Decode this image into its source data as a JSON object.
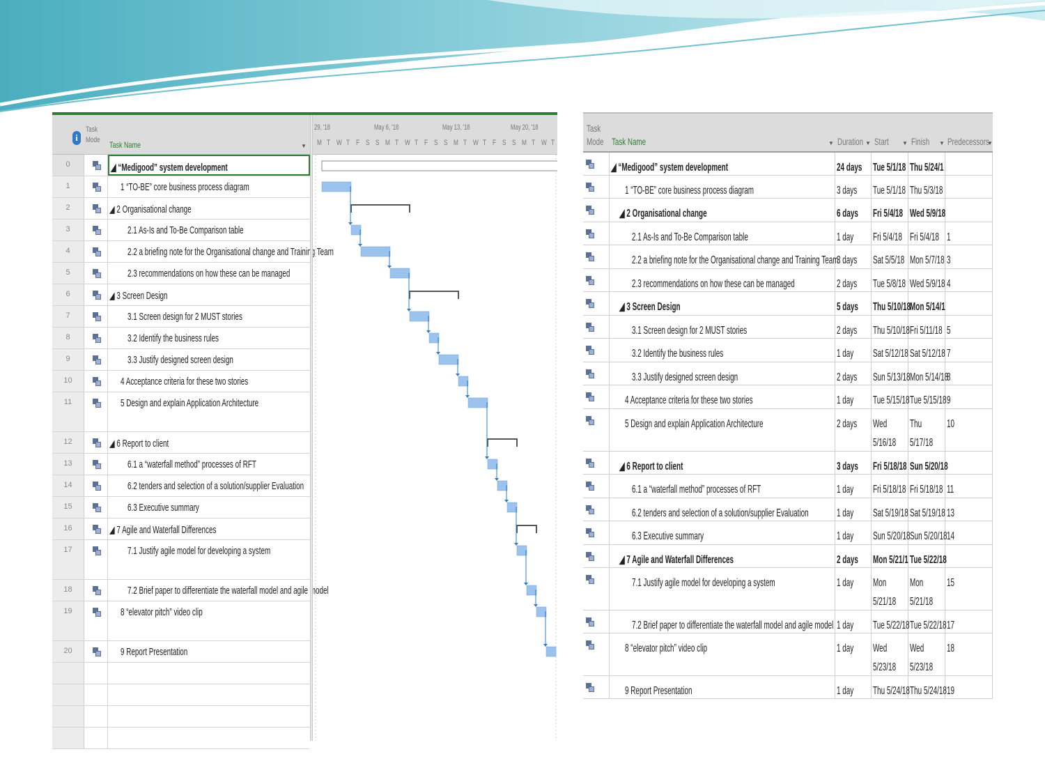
{
  "left_view": {
    "headers": {
      "info_icon": "i",
      "task_mode": "Task Mode",
      "task_name": "Task Name"
    },
    "timeline": {
      "weeks": [
        "29, '18",
        "May 6, '18",
        "May 13, '18",
        "May 20, '18"
      ],
      "day_letters": [
        "M",
        "T",
        "W",
        "T",
        "F",
        "S",
        "S",
        "M",
        "T",
        "W",
        "T",
        "F",
        "S",
        "S",
        "M",
        "T",
        "W",
        "T",
        "F",
        "S",
        "S",
        "M",
        "T",
        "W",
        "T"
      ]
    },
    "rows": [
      {
        "id": "0",
        "name": "◢ “Medigood” system development"
      },
      {
        "id": "1",
        "name": "1 “TO-BE” core business process diagram"
      },
      {
        "id": "2",
        "name": "◢ 2 Organisational change"
      },
      {
        "id": "3",
        "name": "2.1 As-Is and To-Be Comparison table"
      },
      {
        "id": "4",
        "name": "2.2 a briefing note for the Organisational change and Training Team"
      },
      {
        "id": "5",
        "name": "2.3 recommendations on how these can be managed"
      },
      {
        "id": "6",
        "name": "◢ 3 Screen Design"
      },
      {
        "id": "7",
        "name": "3.1 Screen design for 2 MUST stories"
      },
      {
        "id": "8",
        "name": "3.2 Identify the business rules"
      },
      {
        "id": "9",
        "name": "3.3 Justify designed screen design"
      },
      {
        "id": "10",
        "name": "4 Acceptance criteria for these two stories"
      },
      {
        "id": "11",
        "name": "5 Design and explain Application Architecture"
      },
      {
        "id": "12",
        "name": "◢ 6 Report to client"
      },
      {
        "id": "13",
        "name": "6.1 a “waterfall method” processes of RFT"
      },
      {
        "id": "14",
        "name": "6.2 tenders and selection of a solution/supplier Evaluation"
      },
      {
        "id": "15",
        "name": "6.3 Executive summary"
      },
      {
        "id": "16",
        "name": "◢ 7 Agile and Waterfall Differences"
      },
      {
        "id": "17",
        "name": "7.1 Justify agile model for developing a system"
      },
      {
        "id": "18",
        "name": "7.2 Brief paper to differentiate the waterfall model and agile model"
      },
      {
        "id": "19",
        "name": "8 “elevator pitch” video clip"
      },
      {
        "id": "20",
        "name": "9 Report Presentation"
      }
    ]
  },
  "right_view": {
    "headers": {
      "task_mode": "Task Mode",
      "task_name": "Task Name",
      "duration": "Duration",
      "start": "Start",
      "finish": "Finish",
      "predecessors": "Predecessors"
    },
    "rows": [
      {
        "name": "◢ “Medigood” system development",
        "duration": "24 days",
        "start": "Tue 5/1/18",
        "finish": "Thu 5/24/1",
        "pred": ""
      },
      {
        "name": "1 “TO-BE” core business process diagram",
        "duration": "3 days",
        "start": "Tue 5/1/18",
        "finish": "Thu 5/3/18",
        "pred": ""
      },
      {
        "name": "◢ 2 Organisational change",
        "duration": "6 days",
        "start": "Fri 5/4/18",
        "finish": "Wed 5/9/18",
        "pred": ""
      },
      {
        "name": "2.1 As-Is and To-Be Comparison table",
        "duration": "1 day",
        "start": "Fri 5/4/18",
        "finish": "Fri 5/4/18",
        "pred": "1"
      },
      {
        "name": "2.2 a briefing note for the Organisational change and Training Team",
        "duration": "3 days",
        "start": "Sat 5/5/18",
        "finish": "Mon 5/7/18",
        "pred": "3"
      },
      {
        "name": "2.3 recommendations on how these can be managed",
        "duration": "2 days",
        "start": "Tue 5/8/18",
        "finish": "Wed 5/9/18",
        "pred": "4"
      },
      {
        "name": "◢ 3 Screen Design",
        "duration": "5 days",
        "start": "Thu 5/10/18",
        "finish": "Mon 5/14/1",
        "pred": ""
      },
      {
        "name": "3.1 Screen design for 2 MUST stories",
        "duration": "2 days",
        "start": "Thu 5/10/18",
        "finish": "Fri 5/11/18",
        "pred": "5"
      },
      {
        "name": "3.2 Identify the business rules",
        "duration": "1 day",
        "start": "Sat 5/12/18",
        "finish": "Sat 5/12/18",
        "pred": "7"
      },
      {
        "name": "3.3 Justify designed screen design",
        "duration": "2 days",
        "start": "Sun 5/13/18",
        "finish": "Mon 5/14/18",
        "pred": "8"
      },
      {
        "name": "4 Acceptance criteria for these two stories",
        "duration": "1 day",
        "start": "Tue 5/15/18",
        "finish": "Tue 5/15/18",
        "pred": "9"
      },
      {
        "name": "5 Design and explain Application Architecture",
        "duration": "2 days",
        "start": "Wed 5/16/18",
        "finish": "Thu 5/17/18",
        "pred": "10"
      },
      {
        "name": "◢ 6 Report to client",
        "duration": "3 days",
        "start": "Fri 5/18/18",
        "finish": "Sun 5/20/18",
        "pred": ""
      },
      {
        "name": "6.1 a “waterfall method” processes of RFT",
        "duration": "1 day",
        "start": "Fri 5/18/18",
        "finish": "Fri 5/18/18",
        "pred": "11"
      },
      {
        "name": "6.2 tenders and selection of a solution/supplier Evaluation",
        "duration": "1 day",
        "start": "Sat 5/19/18",
        "finish": "Sat 5/19/18",
        "pred": "13"
      },
      {
        "name": "6.3 Executive summary",
        "duration": "1 day",
        "start": "Sun 5/20/18",
        "finish": "Sun 5/20/18",
        "pred": "14"
      },
      {
        "name": "◢ 7 Agile and Waterfall Differences",
        "duration": "2 days",
        "start": "Mon 5/21/1",
        "finish": "Tue 5/22/18",
        "pred": ""
      },
      {
        "name": "7.1 Justify agile model for developing a system",
        "duration": "1 day",
        "start": "Mon 5/21/18",
        "finish": "Mon 5/21/18",
        "pred": "15"
      },
      {
        "name": "7.2 Brief paper to differentiate the waterfall model and agile model",
        "duration": "1 day",
        "start": "Tue 5/22/18",
        "finish": "Tue 5/22/18",
        "pred": "17"
      },
      {
        "name": "8 “elevator pitch” video clip",
        "duration": "1 day",
        "start": "Wed 5/23/18",
        "finish": "Wed 5/23/18",
        "pred": "18"
      },
      {
        "name": "9 Report Presentation",
        "duration": "1 day",
        "start": "Thu 5/24/18",
        "finish": "Thu 5/24/18",
        "pred": "19"
      }
    ]
  },
  "schedule": {
    "project_start": "2018-05-01",
    "tasks": [
      {
        "summary": true,
        "start": "2018-05-01",
        "finish": "2018-05-24"
      },
      {
        "summary": false,
        "start": "2018-05-01",
        "finish": "2018-05-03"
      },
      {
        "summary": true,
        "start": "2018-05-04",
        "finish": "2018-05-09"
      },
      {
        "summary": false,
        "start": "2018-05-04",
        "finish": "2018-05-04"
      },
      {
        "summary": false,
        "start": "2018-05-05",
        "finish": "2018-05-07"
      },
      {
        "summary": false,
        "start": "2018-05-08",
        "finish": "2018-05-09"
      },
      {
        "summary": true,
        "start": "2018-05-10",
        "finish": "2018-05-14"
      },
      {
        "summary": false,
        "start": "2018-05-10",
        "finish": "2018-05-11"
      },
      {
        "summary": false,
        "start": "2018-05-12",
        "finish": "2018-05-12"
      },
      {
        "summary": false,
        "start": "2018-05-13",
        "finish": "2018-05-14"
      },
      {
        "summary": false,
        "start": "2018-05-15",
        "finish": "2018-05-15"
      },
      {
        "summary": false,
        "start": "2018-05-16",
        "finish": "2018-05-17"
      },
      {
        "summary": true,
        "start": "2018-05-18",
        "finish": "2018-05-20"
      },
      {
        "summary": false,
        "start": "2018-05-18",
        "finish": "2018-05-18"
      },
      {
        "summary": false,
        "start": "2018-05-19",
        "finish": "2018-05-19"
      },
      {
        "summary": false,
        "start": "2018-05-20",
        "finish": "2018-05-20"
      },
      {
        "summary": true,
        "start": "2018-05-21",
        "finish": "2018-05-22"
      },
      {
        "summary": false,
        "start": "2018-05-21",
        "finish": "2018-05-21"
      },
      {
        "summary": false,
        "start": "2018-05-22",
        "finish": "2018-05-22"
      },
      {
        "summary": false,
        "start": "2018-05-23",
        "finish": "2018-05-23"
      },
      {
        "summary": false,
        "start": "2018-05-24",
        "finish": "2018-05-24"
      }
    ]
  },
  "colors": {
    "accent": "#2e7d32",
    "bar": "#9cc3ee",
    "bar_border": "#6a9fd6",
    "summary": "#555555",
    "link": "#2f79c9",
    "swoosh_dark": "#5fb3c4",
    "swoosh_light": "#bfe6ee"
  }
}
